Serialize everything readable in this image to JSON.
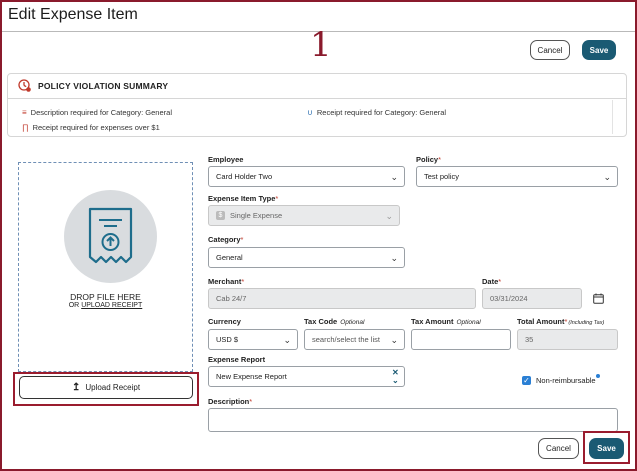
{
  "header": {
    "title": "Edit Expense Item",
    "step_number": "1"
  },
  "top_actions": {
    "cancel_label": "Cancel",
    "save_label": "Save"
  },
  "policy_summary": {
    "title": "POLICY VIOLATION SUMMARY",
    "violations": [
      {
        "text": "Description required for Category: General",
        "icon": "description-flag-icon"
      },
      {
        "text": "Receipt required for Category: General",
        "icon": "receipt-flag-icon"
      },
      {
        "text": "Receipt required for expenses over $1",
        "icon": "receipt-amount-flag-icon"
      }
    ]
  },
  "receipt": {
    "drop_text": "DROP FILE HERE",
    "or_text": "OR",
    "upload_link": "UPLOAD RECEIPT",
    "upload_button": "Upload Receipt"
  },
  "form": {
    "employee": {
      "label": "Employee",
      "value": "Card Holder Two"
    },
    "policy": {
      "label": "Policy",
      "required": "*",
      "value": "Test policy"
    },
    "expense_item_type": {
      "label": "Expense Item Type",
      "required": "*",
      "value": "Single Expense"
    },
    "category": {
      "label": "Category",
      "required": "*",
      "value": "General"
    },
    "merchant": {
      "label": "Merchant",
      "required": "*",
      "value": "Cab 24/7"
    },
    "date": {
      "label": "Date",
      "required": "*",
      "value": "03/31/2024"
    },
    "currency": {
      "label": "Currency",
      "value": "USD $"
    },
    "tax_code": {
      "label": "Tax Code",
      "optional": "Optional",
      "placeholder": "search/select the list"
    },
    "tax_amount": {
      "label": "Tax Amount",
      "optional": "Optional",
      "value": ""
    },
    "total_amount": {
      "label": "Total Amount",
      "required": "*",
      "note": "(Including Tax)",
      "value": "35"
    },
    "expense_report": {
      "label": "Expense Report",
      "value": "New Expense Report"
    },
    "non_reimbursable": {
      "label": "Non-reimbursable",
      "checked": true
    },
    "description": {
      "label": "Description",
      "required": "*",
      "value": ""
    }
  },
  "bottom_actions": {
    "cancel_label": "Cancel",
    "save_label": "Save"
  },
  "colors": {
    "accent": "#1a5a73",
    "highlight": "#9a1c2e",
    "required": "#c0392b"
  }
}
